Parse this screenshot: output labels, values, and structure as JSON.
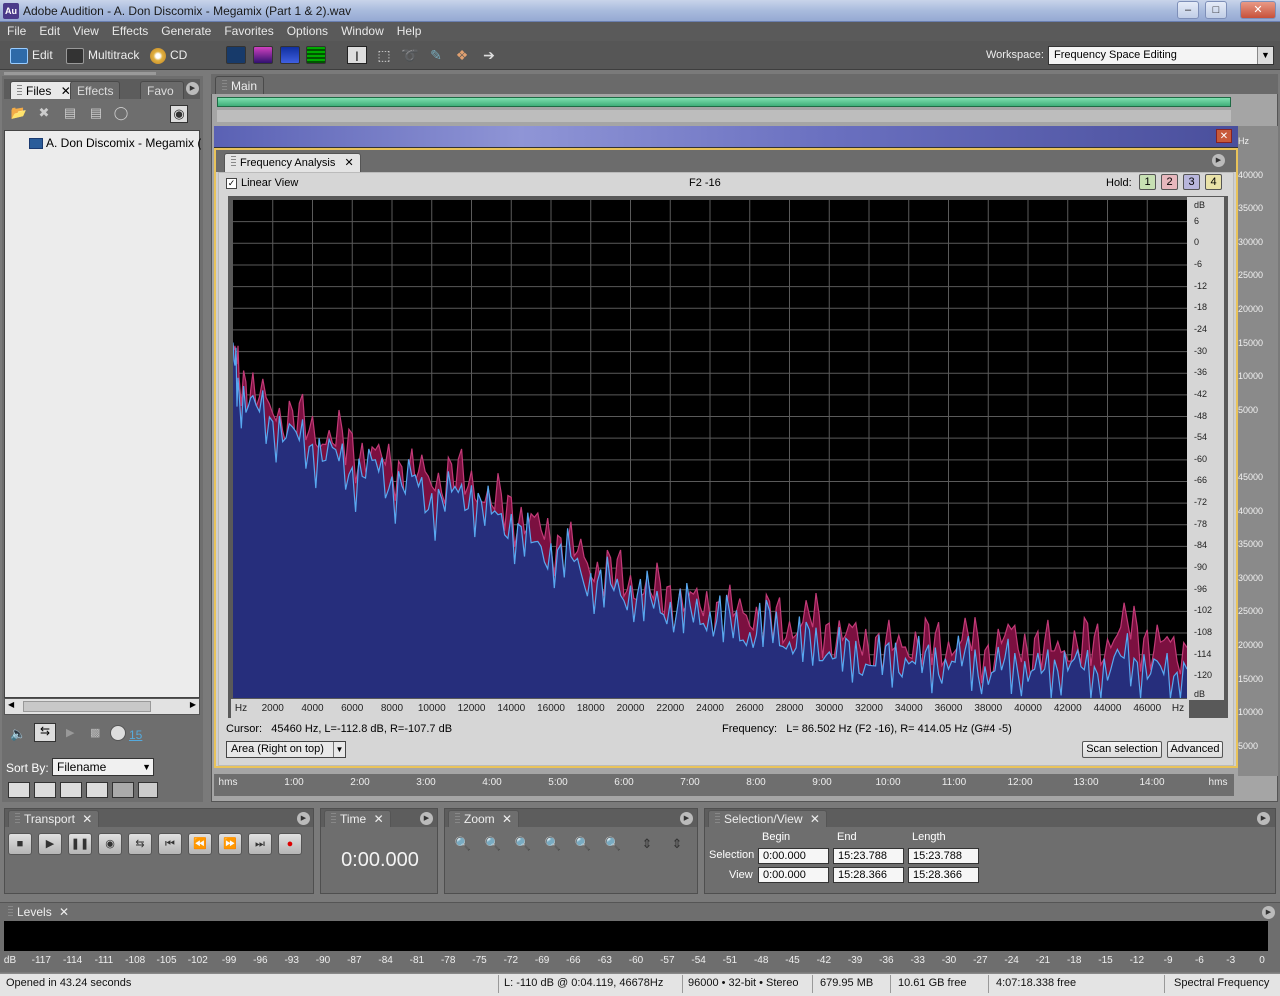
{
  "app": {
    "icon_text": "Au",
    "window_title": "Adobe Audition - A. Don Discomix - Megamix (Part 1 & 2).wav"
  },
  "menu": [
    "File",
    "Edit",
    "View",
    "Effects",
    "Generate",
    "Favorites",
    "Options",
    "Window",
    "Help"
  ],
  "toolbar": {
    "edit_label": "Edit",
    "multitrack_label": "Multitrack",
    "cd_label": "CD",
    "workspace_label": "Workspace:",
    "workspace_value": "Frequency Space Editing"
  },
  "left_panel": {
    "tabs": [
      "Files",
      "Effects",
      "Favo"
    ],
    "file_item": "A. Don Discomix - Megamix (Part",
    "loop_count": "15",
    "sort_by_label": "Sort By:",
    "sort_by_value": "Filename"
  },
  "main": {
    "tab": "Main"
  },
  "freq_analysis": {
    "tab": "Frequency Analysis",
    "linear_view_label": "Linear View",
    "linear_view_checked": true,
    "note": "F2 -16",
    "hold_label": "Hold:",
    "hold_buttons": [
      "1",
      "2",
      "3",
      "4"
    ],
    "hold_colors": [
      "#c7e0b3",
      "#e7b7bd",
      "#b8b6dc",
      "#e9e2a8"
    ],
    "cursor_label": "Cursor:",
    "cursor_value": "45460 Hz, L=-112.8 dB, R=-107.7 dB",
    "frequency_label": "Frequency:",
    "frequency_value": "L= 86.502 Hz (F2 -16), R= 414.05 Hz (G#4 -5)",
    "mode": "Area (Right on top)",
    "scan_button": "Scan selection",
    "advanced_button": "Advanced"
  },
  "chart_data": {
    "type": "area",
    "x_unit_label": "Hz",
    "y_unit_label": "dB",
    "x_ticks": [
      "2000",
      "4000",
      "6000",
      "8000",
      "10000",
      "12000",
      "14000",
      "16000",
      "18000",
      "20000",
      "22000",
      "24000",
      "26000",
      "28000",
      "30000",
      "32000",
      "34000",
      "36000",
      "38000",
      "40000",
      "42000",
      "44000",
      "46000"
    ],
    "y_ticks": [
      "6",
      "0",
      "-6",
      "-12",
      "-18",
      "-24",
      "-30",
      "-36",
      "-42",
      "-48",
      "-54",
      "-60",
      "-66",
      "-72",
      "-78",
      "-84",
      "-90",
      "-96",
      "-102",
      "-108",
      "-114",
      "-120"
    ],
    "xlim": [
      0,
      48000
    ],
    "ylim": [
      -126,
      12
    ],
    "grid": true,
    "series": [
      {
        "colors": [
          "#7b1040",
          "#c23a77"
        ],
        "x": [
          0,
          300,
          1000,
          2000,
          3000,
          4000,
          5000,
          6000,
          7000,
          8000,
          9000,
          10000,
          11000,
          12000,
          13000,
          14000,
          15000,
          16000,
          17000,
          18000,
          19000,
          20000,
          21000,
          22000,
          23000,
          24000,
          25000,
          26000,
          27000,
          28000,
          29000,
          30000,
          31000,
          32000,
          33000,
          34000,
          35000,
          36000,
          37000,
          38000,
          39000,
          40000,
          41000,
          42000,
          43000,
          44000,
          45000,
          46000,
          47000,
          48000
        ],
        "values": [
          -28,
          -34,
          -40,
          -44,
          -47,
          -50,
          -52,
          -55,
          -57,
          -60,
          -62,
          -63,
          -63,
          -64,
          -70,
          -72,
          -76,
          -80,
          -83,
          -87,
          -90,
          -92,
          -95,
          -96,
          -98,
          -99,
          -101,
          -100,
          -103,
          -104,
          -102,
          -106,
          -107,
          -109,
          -111,
          -108,
          -110,
          -109,
          -108,
          -112,
          -107,
          -110,
          -111,
          -109,
          -110,
          -108,
          -104,
          -108,
          -110,
          -112
        ]
      },
      {
        "colors": [
          "#262e7c",
          "#58a8f0"
        ],
        "x": [
          0,
          300,
          1000,
          2000,
          3000,
          4000,
          5000,
          6000,
          7000,
          8000,
          9000,
          10000,
          11000,
          12000,
          13000,
          14000,
          15000,
          16000,
          17000,
          18000,
          19000,
          20000,
          21000,
          22000,
          23000,
          24000,
          25000,
          26000,
          27000,
          28000,
          29000,
          30000,
          31000,
          32000,
          33000,
          34000,
          35000,
          36000,
          37000,
          38000,
          39000,
          40000,
          41000,
          42000,
          43000,
          44000,
          45000,
          46000,
          47000,
          48000
        ],
        "values": [
          -30,
          -39,
          -44,
          -48,
          -52,
          -55,
          -57,
          -62,
          -60,
          -65,
          -64,
          -70,
          -68,
          -68,
          -74,
          -76,
          -82,
          -84,
          -86,
          -92,
          -94,
          -95,
          -98,
          -99,
          -101,
          -101,
          -104,
          -106,
          -104,
          -108,
          -110,
          -110,
          -114,
          -113,
          -115,
          -112,
          -116,
          -113,
          -114,
          -117,
          -115,
          -116,
          -118,
          -113,
          -118,
          -116,
          -113,
          -116,
          -118,
          -118
        ]
      }
    ]
  },
  "timeline_ticks": [
    "hms",
    "1:00",
    "2:00",
    "3:00",
    "4:00",
    "5:00",
    "6:00",
    "7:00",
    "8:00",
    "9:00",
    "10:00",
    "11:00",
    "12:00",
    "13:00",
    "14:00",
    "hms"
  ],
  "right_ruler": [
    "Hz",
    "40000",
    "35000",
    "30000",
    "25000",
    "20000",
    "15000",
    "10000",
    "5000",
    "",
    "45000",
    "40000",
    "35000",
    "30000",
    "25000",
    "20000",
    "15000",
    "10000",
    "5000"
  ],
  "transport": {
    "title": "Transport"
  },
  "time": {
    "title": "Time",
    "value": "0:00.000"
  },
  "zoom": {
    "title": "Zoom"
  },
  "selection": {
    "title": "Selection/View",
    "headers": [
      "Begin",
      "End",
      "Length"
    ],
    "row_labels": [
      "Selection",
      "View"
    ],
    "selection": [
      "0:00.000",
      "15:23.788",
      "15:23.788"
    ],
    "view": [
      "0:00.000",
      "15:28.366",
      "15:28.366"
    ]
  },
  "levels": {
    "title": "Levels",
    "ticks": [
      "dB",
      "-117",
      "-114",
      "-111",
      "-108",
      "-105",
      "-102",
      "-99",
      "-96",
      "-93",
      "-90",
      "-87",
      "-84",
      "-81",
      "-78",
      "-75",
      "-72",
      "-69",
      "-66",
      "-63",
      "-60",
      "-57",
      "-54",
      "-51",
      "-48",
      "-45",
      "-42",
      "-39",
      "-36",
      "-33",
      "-30",
      "-27",
      "-24",
      "-21",
      "-18",
      "-15",
      "-12",
      "-9",
      "-6",
      "-3",
      "0"
    ]
  },
  "status": {
    "opened": "Opened in 43.24 seconds",
    "levels": "L: -110 dB @  0:04.119, 46678Hz",
    "format": "96000 • 32-bit • Stereo",
    "size": "679.95 MB",
    "free": "10.61 GB free",
    "time_free": "4:07:18.338 free",
    "view": "Spectral Frequency"
  }
}
